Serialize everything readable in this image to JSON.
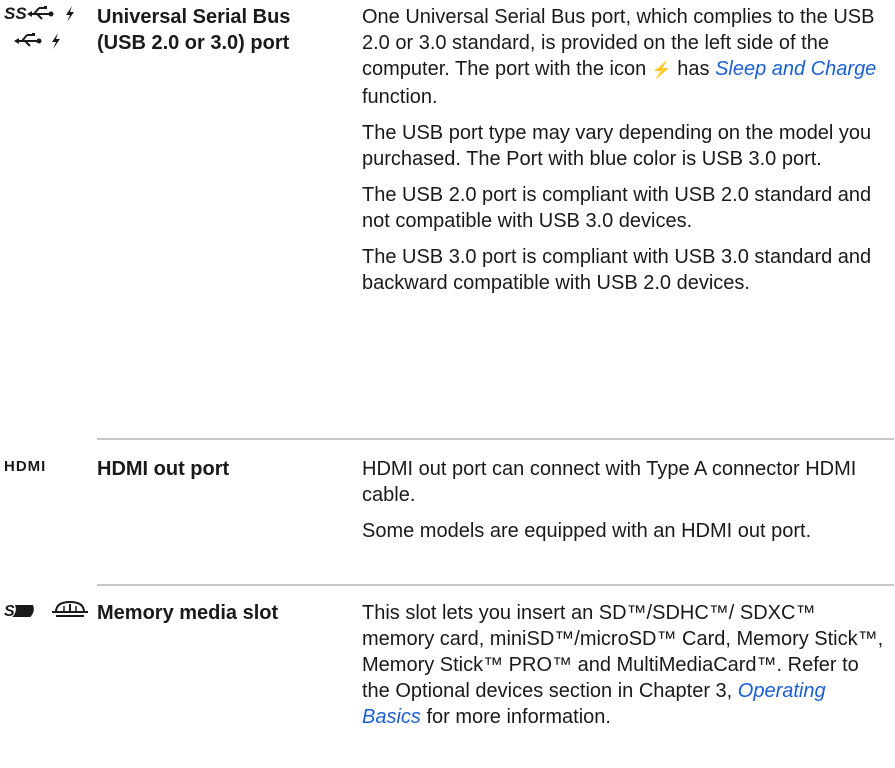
{
  "rows": [
    {
      "id": "usb",
      "icons": [
        "usb-superspeed-sleep-charge-icon",
        "usb-sleep-charge-icon"
      ],
      "term": "Universal Serial Bus (USB 2.0 or 3.0) port",
      "paragraphs": [
        {
          "pre": "One Universal Serial Bus port, which complies to the USB 2.0 or 3.0 standard, is provided on the left side of the computer. The port with the icon ",
          "bolt": "⚡",
          "mid": " has ",
          "link": "Sleep and Charge",
          "post": " function."
        },
        "The USB port type may vary depending on the model you purchased. The Port with blue color is USB 3.0 port.",
        "The USB 2.0 port is compliant with USB 2.0 standard and not compatible with USB 3.0 devices.",
        "The USB 3.0 port is compliant with USB 3.0 standard and backward compatible with USB 2.0 devices."
      ]
    },
    {
      "id": "hdmi",
      "icons": [
        "hdmi-icon"
      ],
      "icon_text": "HDMI",
      "term": "HDMI out port",
      "paragraphs": [
        "HDMI out port can connect with Type A connector HDMI cable.",
        "Some models are equipped with an HDMI out port."
      ]
    },
    {
      "id": "memory",
      "icons": [
        "sd-card-icon",
        "memory-stick-icon"
      ],
      "term": "Memory media slot",
      "paragraphs": [
        {
          "pre": "This slot lets you insert an SD™/SDHC™/ SDXC™ memory card, miniSD™/microSD™ Card, Memory Stick™, Memory Stick™ PRO™ and MultiMediaCard™. Refer to the Optional devices section in Chapter 3, ",
          "link": "Operating Basics",
          "post": " for more information."
        }
      ]
    }
  ]
}
